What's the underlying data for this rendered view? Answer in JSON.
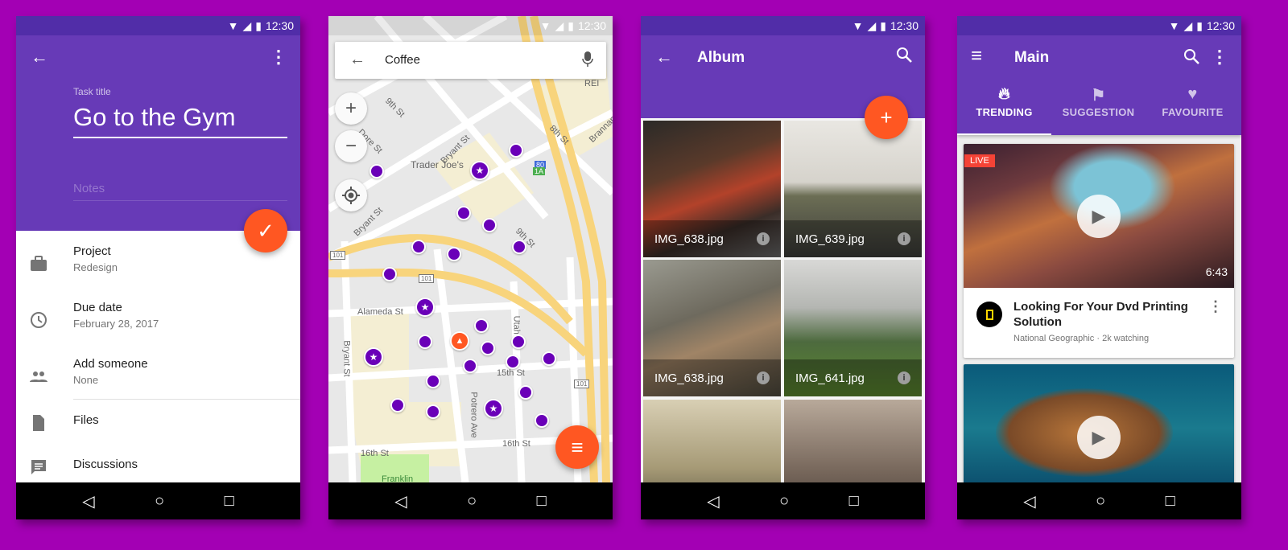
{
  "status": {
    "time": "12:30"
  },
  "colors": {
    "primary": "#673ab7",
    "primary_dark": "#512da8",
    "accent": "#ff5722",
    "background": "#a300b4"
  },
  "task": {
    "task_title_label": "Task title",
    "task_title_value": "Go to the Gym",
    "notes_placeholder": "Notes",
    "items": [
      {
        "icon": "briefcase-icon",
        "title": "Project",
        "subtitle": "Redesign"
      },
      {
        "icon": "clock-icon",
        "title": "Due date",
        "subtitle": "February 28, 2017"
      },
      {
        "icon": "people-icon",
        "title": "Add someone",
        "subtitle": "None"
      },
      {
        "icon": "file-icon",
        "title": "Files"
      },
      {
        "icon": "comment-icon",
        "title": "Discussions"
      }
    ]
  },
  "map": {
    "search_value": "Coffee",
    "labels": {
      "9th_a": "9th St",
      "dore": "Dore St",
      "bryant_a": "Bryant St",
      "trader": "Trader Joe's",
      "bryant_b": "Bryant St",
      "9th_b": "9th St",
      "8th_a": "8th St",
      "brannan": "Brannan St",
      "rei": "REI",
      "i80": "80",
      "1a": "1A",
      "us101_a": "101",
      "us101_b": "101",
      "us101_c": "101",
      "alameda": "Alameda St",
      "utah_a": "Utah St",
      "bryant_c": "Bryant St",
      "15th": "15th St",
      "potrero": "Potrero Ave",
      "16th_a": "16th St",
      "16th_b": "16th St",
      "franklin": "Franklin"
    }
  },
  "album": {
    "title": "Album",
    "photos": [
      {
        "name": "IMG_638.jpg"
      },
      {
        "name": "IMG_639.jpg"
      },
      {
        "name": "IMG_638.jpg"
      },
      {
        "name": "IMG_641.jpg"
      },
      {
        "name": ""
      },
      {
        "name": ""
      }
    ]
  },
  "main": {
    "title": "Main",
    "tabs": [
      {
        "label": "TRENDING",
        "icon": "fire-icon"
      },
      {
        "label": "SUGGESTION",
        "icon": "flag-icon"
      },
      {
        "label": "FAVOURITE",
        "icon": "heart-icon"
      }
    ],
    "cards": [
      {
        "badge": "LIVE",
        "duration": "6:43",
        "title": "Looking For Your Dvd Printing Solution",
        "channel": "National Geographic",
        "meta": "2k watching"
      }
    ]
  }
}
